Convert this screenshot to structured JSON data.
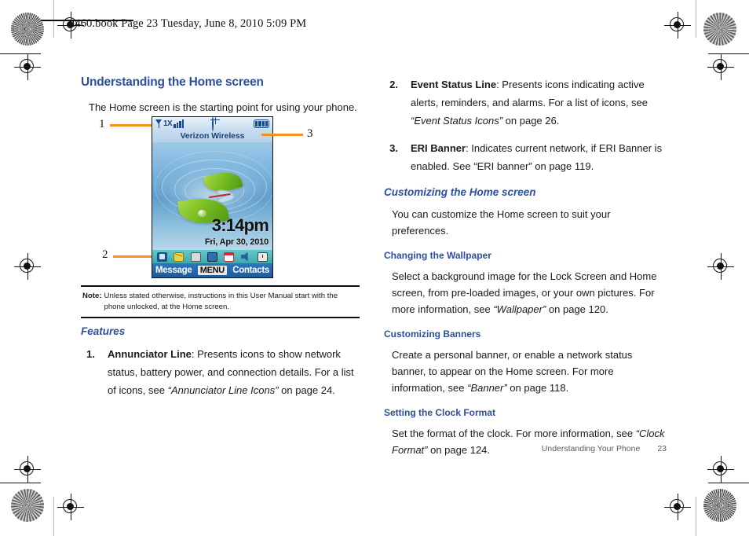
{
  "header": {
    "text": "u460.book  Page 23  Tuesday, June 8, 2010  5:09 PM"
  },
  "colors": {
    "heading_blue": "#2b4f9e",
    "callout_orange": "#f0941e",
    "body_black": "#1a1a1a",
    "footer_grey": "#5a5a5a"
  },
  "left_column": {
    "section_title": "Understanding the Home screen",
    "intro": "The Home screen is the starting point for using your phone.",
    "features_heading": "Features",
    "features": [
      {
        "number": "1.",
        "term": "Annunciator Line",
        "text_before": ": Presents icons to show network status, battery power, and connection details. For a list of icons, see ",
        "reference": "“Annunciator Line Icons”",
        "text_after": " on page 24."
      }
    ]
  },
  "note": {
    "label": "Note:",
    "text": "Unless stated otherwise, instructions in this User Manual start with the phone unlocked, at the Home screen."
  },
  "callouts": [
    {
      "label": "1"
    },
    {
      "label": "2"
    },
    {
      "label": "3"
    }
  ],
  "phone": {
    "annunciator": {
      "signal_icon": "signal-bars-icon",
      "network_label": "1X",
      "strength_icon": "signal-strength-icon",
      "gps_icon": "gps-icon",
      "battery_icon": "battery-full-icon"
    },
    "banner": "Verizon Wireless",
    "time": "3:14pm",
    "date": "Fri, Apr 30, 2010",
    "event_icons": [
      "vibrate-icon",
      "new-message-icon",
      "voicemail-icon",
      "tty-icon",
      "calendar-event-icon",
      "speaker-icon",
      "alarm-icon"
    ],
    "softkeys": {
      "left": "Message",
      "center": "MENU",
      "right": "Contacts"
    }
  },
  "right_column": {
    "features": [
      {
        "number": "2.",
        "term": "Event Status Line",
        "text_before": ": Presents icons indicating active alerts, reminders, and alarms. For a list of icons, see ",
        "reference": "“Event Status Icons”",
        "text_after": " on page 26."
      },
      {
        "number": "3.",
        "term": "ERI Banner",
        "text_before": ": Indicates current network, if ERI Banner is enabled. See “ERI banner” on page 119.",
        "reference": "",
        "text_after": ""
      }
    ],
    "customizing_heading": "Customizing the Home screen",
    "customizing_intro": "You can customize the Home screen to suit your preferences.",
    "subsections": [
      {
        "heading": "Changing the Wallpaper",
        "text_before": "Select a background image for the Lock Screen and Home screen, from pre-loaded images, or your own pictures. For more information, see ",
        "reference": "“Wallpaper”",
        "text_after": " on page 120."
      },
      {
        "heading": "Customizing Banners",
        "text_before": "Create a personal banner, or enable a network status banner, to appear on the Home screen. For more information, see ",
        "reference": "“Banner”",
        "text_after": " on page 118."
      },
      {
        "heading": "Setting the Clock Format",
        "text_before": "Set the format of the clock. For more information, see ",
        "reference": "“Clock Format”",
        "text_after": " on page 124."
      }
    ]
  },
  "footer": {
    "chapter": "Understanding Your Phone",
    "page_number": "23"
  }
}
